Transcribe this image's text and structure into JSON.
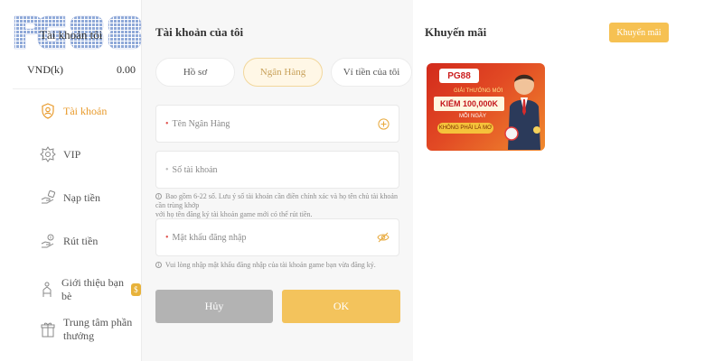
{
  "sidebar": {
    "logo_text": "PG88",
    "account_label": "Tài khoản tôi",
    "balance": {
      "currency": "VND(k)",
      "value": "0.00"
    },
    "items": [
      {
        "label": "Tài khoản",
        "icon": "user-shield-icon",
        "active": true
      },
      {
        "label": "VIP",
        "icon": "vip-badge-icon",
        "active": false
      },
      {
        "label": "Nạp tiền",
        "icon": "deposit-hand-icon",
        "active": false
      },
      {
        "label": "Rút tiền",
        "icon": "withdraw-hand-icon",
        "active": false
      },
      {
        "label": "Giới thiệu bạn bè",
        "icon": "refer-friend-icon",
        "active": false,
        "badge_icon": "coin-bag-icon"
      },
      {
        "label_line1": "Trung tâm phần",
        "label_line2": "thưởng",
        "icon": "gift-icon",
        "active": false
      }
    ]
  },
  "main": {
    "title": "Tài khoản của tôi",
    "tabs": [
      {
        "label": "Hồ sơ",
        "active": false
      },
      {
        "label": "Ngân Hàng",
        "active": true
      },
      {
        "label": "Ví tiền của tôi",
        "active": false
      }
    ],
    "fields": {
      "bank_name": {
        "placeholder": "Tên Ngân Hàng",
        "required": true,
        "icon": "plus-circle-icon"
      },
      "account_number": {
        "placeholder": "Số tài khoản",
        "required": false
      },
      "password": {
        "placeholder": "Mật khẩu đăng nhập",
        "required": true,
        "icon": "eye-off-icon"
      }
    },
    "hints": {
      "account_hint_line1": "Bao gồm 6-22 số. Lưu ý số tài khoản cần điền chính xác và họ tên chủ tài khoản cần trùng khớp",
      "account_hint_line2": "với họ tên đăng ký tài khoản game mới có thể rút tiền.",
      "password_hint": "Vui lòng nhập mật khẩu đăng nhập của tài khoản game bạn vừa đăng ký."
    },
    "buttons": {
      "cancel": "Hủy",
      "ok": "OK"
    }
  },
  "promo": {
    "title": "Khuyến mãi",
    "button": "Khuyến mãi",
    "card": {
      "brand": "PG88",
      "tag1": "GIẢI THƯỞNG MỚI",
      "headline": "KIẾM 100,000K",
      "tag2": "MỖI NGÀY",
      "tag3": "KHÔNG PHẢI LÀ MƠ"
    }
  },
  "colors": {
    "accent": "#f3c35c",
    "active_text": "#e89a2b",
    "cancel": "#b3b3b3",
    "required": "#e0504b"
  }
}
